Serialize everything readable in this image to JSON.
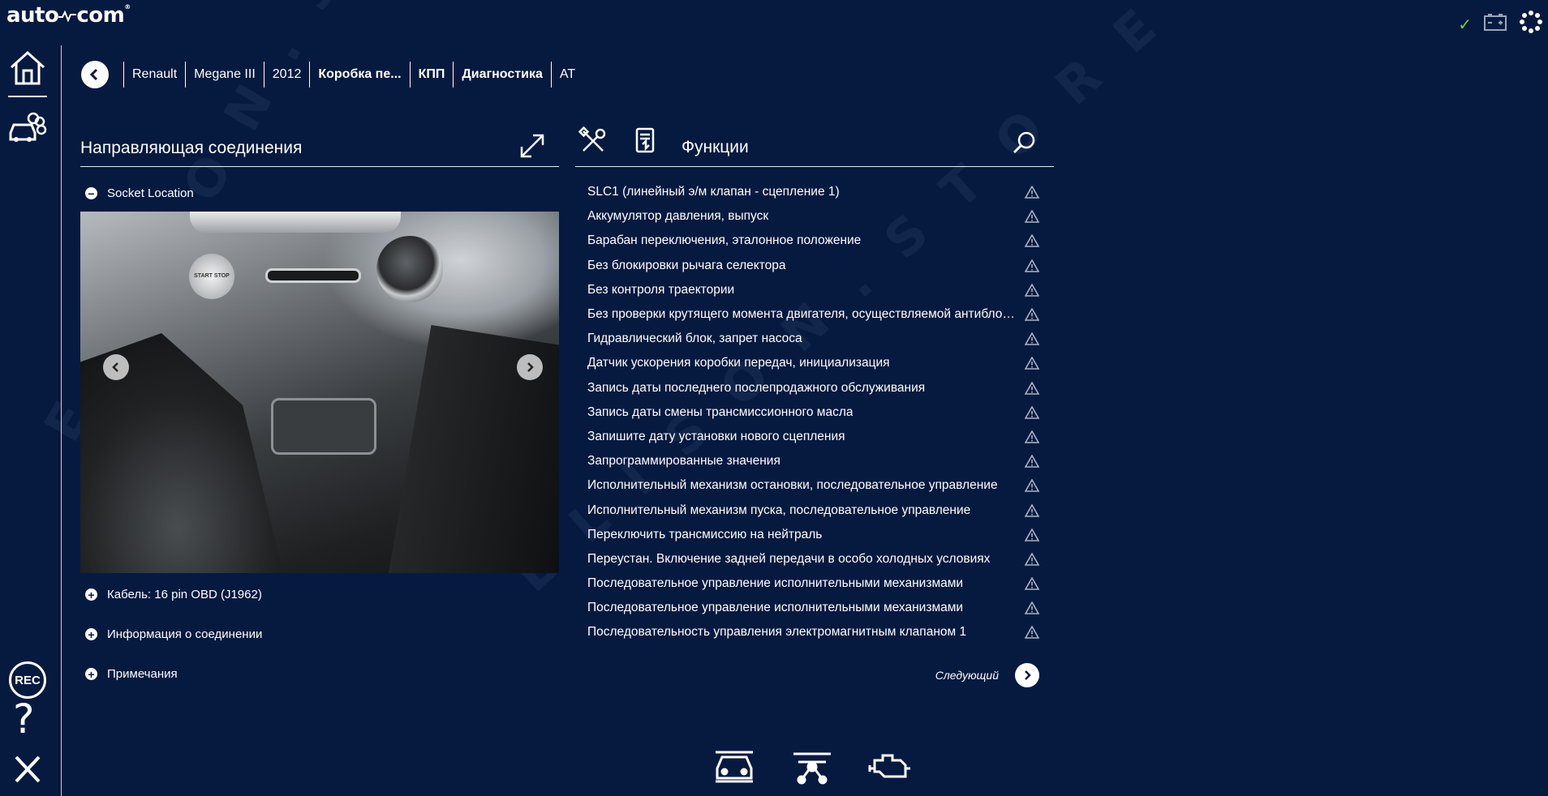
{
  "app": {
    "logo_text": "auto",
    "logo_text_end": "com"
  },
  "breadcrumb": {
    "items": [
      {
        "label": "Renault",
        "bold": false
      },
      {
        "label": "Megane III",
        "bold": false
      },
      {
        "label": "2012",
        "bold": false
      },
      {
        "label": "Коробка пе...",
        "bold": true
      },
      {
        "label": "КПП",
        "bold": true
      },
      {
        "label": "Диагностика",
        "bold": true
      },
      {
        "label": "AT",
        "bold": false
      }
    ]
  },
  "left_panel": {
    "title": "Направляющая соединения",
    "socket_location": "Socket Location",
    "photo_button_text": "START STOP",
    "sections": [
      "Кабель: 16 pin OBD (J1962)",
      "Информация о соединении",
      "Примечания"
    ]
  },
  "right_panel": {
    "title": "Функции",
    "functions": [
      "SLC1 (линейный э/м клапан - сцепление 1)",
      "Аккумулятор давления, выпуск",
      "Барабан переключения, эталонное положение",
      "Без блокировки рычага селектора",
      "Без контроля траектории",
      "Без проверки крутящего момента двигателя, осуществляемой антиблокировочной системой",
      "Гидравлический блок, запрет насоса",
      "Датчик ускорения коробки передач, инициализация",
      "Запись даты последнего послепродажного обслуживания",
      "Запись даты смены трансмиссионного масла",
      "Запишите дату установки нового сцепления",
      "Запрограммированные значения",
      "Исполнительный механизм остановки, последовательное управление",
      "Исполнительный механизм пуска, последовательное управление",
      "Переключить трансмиссию на нейтраль",
      "Переустан. Включение задней передачи в особо холодных условиях",
      "Последовательное управление исполнительными механизмами",
      "Последовательное управление исполнительными механизмами",
      "Последовательность управления электромагнитным клапаном 1"
    ],
    "next_label": "Следующий"
  },
  "sidebar": {
    "rec_label": "REC",
    "help_label": "?"
  },
  "watermark": "ELISON.STORE",
  "status": {
    "connected_mark": "✓"
  },
  "colors": {
    "background": "#061a40",
    "accent_ok": "#6fd24a",
    "text": "#ffffff"
  },
  "icons": [
    "home-icon",
    "vehicle-icon",
    "close-icon",
    "expand-icon",
    "tools-icon",
    "ecu-icon",
    "search-icon",
    "warning-icon",
    "battery-icon",
    "settings-gear-icon",
    "car-front-icon",
    "network-icon",
    "engine-icon"
  ]
}
